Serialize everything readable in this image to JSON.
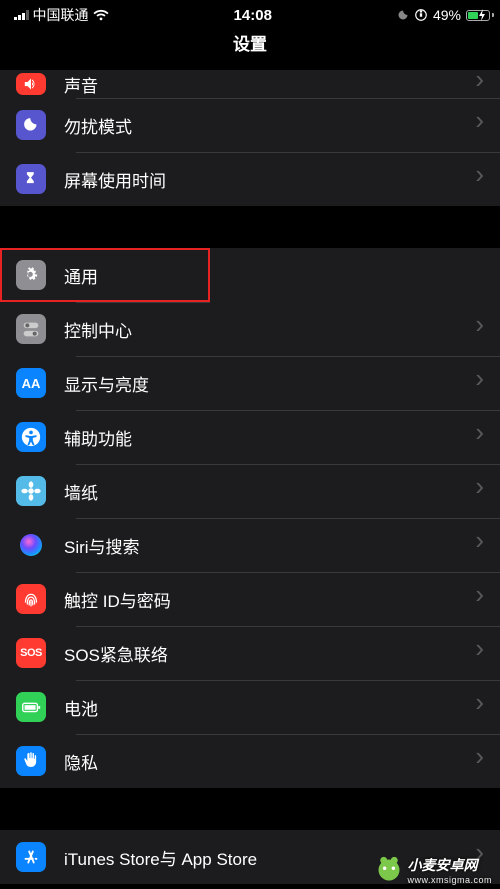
{
  "status": {
    "carrier": "中国联通",
    "time": "14:08",
    "battery_pct": "49%"
  },
  "header": {
    "title": "设置"
  },
  "groups": [
    {
      "rows": [
        {
          "key": "sound",
          "label": "声音",
          "icon": "ic-sound",
          "svg": "speaker"
        },
        {
          "key": "dnd",
          "label": "勿扰模式",
          "icon": "ic-dnd",
          "svg": "moon"
        },
        {
          "key": "screentime",
          "label": "屏幕使用时间",
          "icon": "ic-screentime",
          "svg": "hourglass"
        }
      ]
    },
    {
      "rows": [
        {
          "key": "general",
          "label": "通用",
          "icon": "ic-general",
          "svg": "gear",
          "highlighted": true
        },
        {
          "key": "control",
          "label": "控制中心",
          "icon": "ic-control",
          "svg": "switches"
        },
        {
          "key": "display",
          "label": "显示与亮度",
          "icon": "ic-display",
          "text": "AA"
        },
        {
          "key": "access",
          "label": "辅助功能",
          "icon": "ic-access",
          "svg": "accessibility"
        },
        {
          "key": "wallpaper",
          "label": "墙纸",
          "icon": "ic-wallpaper",
          "svg": "flower"
        },
        {
          "key": "siri",
          "label": "Siri与搜索",
          "icon": "ic-siri",
          "orb": true
        },
        {
          "key": "touchid",
          "label": "触控 ID与密码",
          "icon": "ic-touchid",
          "svg": "fingerprint"
        },
        {
          "key": "sos",
          "label": "SOS紧急联络",
          "icon": "ic-sos",
          "text": "SOS"
        },
        {
          "key": "battery",
          "label": "电池",
          "icon": "ic-battery",
          "svg": "battery"
        },
        {
          "key": "privacy",
          "label": "隐私",
          "icon": "ic-privacy",
          "svg": "hand"
        }
      ]
    },
    {
      "rows": [
        {
          "key": "appstore",
          "label": "iTunes Store与 App Store",
          "icon": "ic-appstore",
          "svg": "appstore"
        }
      ]
    }
  ],
  "watermark": {
    "name": "小麦安卓网",
    "url": "www.xmsigma.com"
  }
}
